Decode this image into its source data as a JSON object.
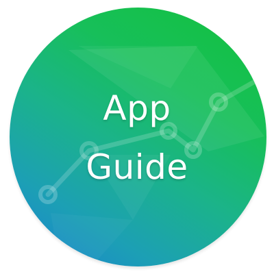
{
  "logo": {
    "title_line_1": "App",
    "title_line_2": "Guide",
    "icon": "app-guide-badge-icon",
    "colors": {
      "gradient_blue": "#1a7fd3",
      "gradient_teal": "#1bb38a",
      "gradient_green": "#13c13c",
      "text": "#ffffff"
    }
  }
}
